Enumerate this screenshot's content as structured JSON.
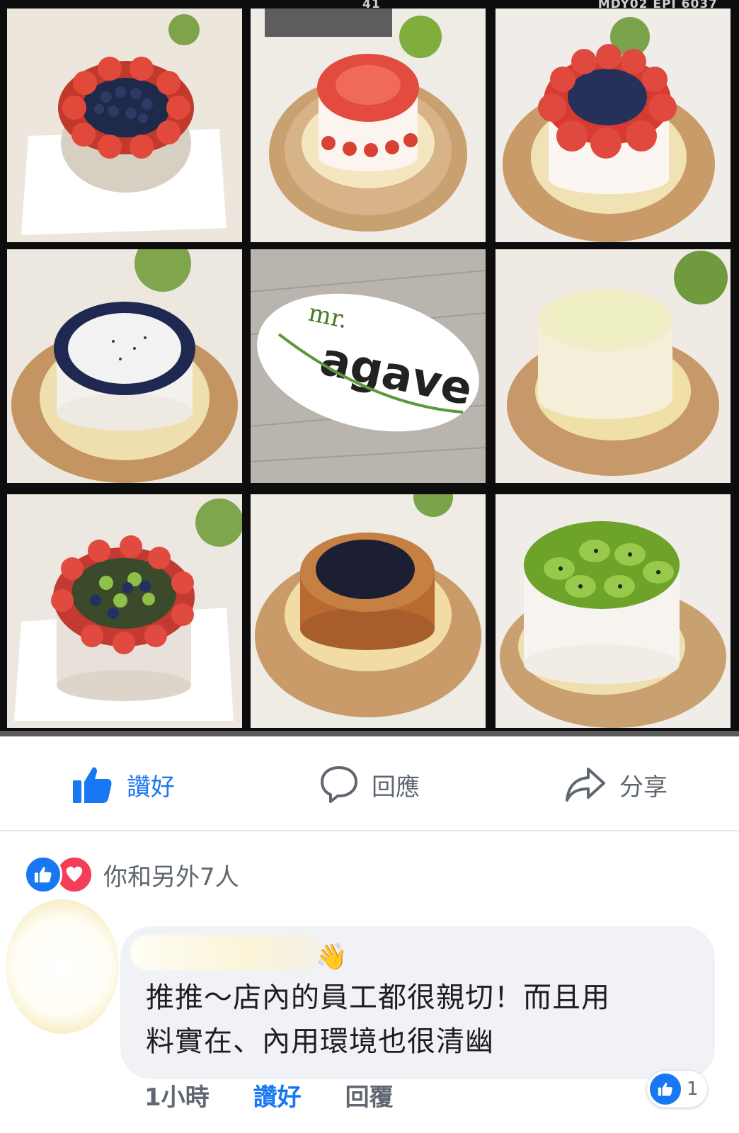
{
  "collage": {
    "film_number": "41",
    "film_code": "MDY02 EPI 6037",
    "logo_text_top": "mr.",
    "logo_text_main": "agave",
    "tiles": [
      {
        "name": "strawberry-blueberry-cake"
      },
      {
        "name": "strawberry-fraisier-cake"
      },
      {
        "name": "strawberry-blueberry-tall-cake"
      },
      {
        "name": "blueberry-ring-cake"
      },
      {
        "name": "mr-agave-logo"
      },
      {
        "name": "lemon-mousse-cake"
      },
      {
        "name": "mixed-fruit-cake"
      },
      {
        "name": "blueberry-cheesecake"
      },
      {
        "name": "kiwi-cake"
      }
    ]
  },
  "actions": {
    "like_label": "讚好",
    "comment_label": "回應",
    "share_label": "分享",
    "like_color": "#1877f2"
  },
  "reactions": {
    "summary": "你和另外7人",
    "types": [
      "like-icon",
      "love-icon"
    ]
  },
  "comment": {
    "wave_emoji": "👋",
    "text_line1": "推推～店內的員工都很親切！而且用",
    "text_line2": "料實在、內用環境也很清幽",
    "time": "1小時",
    "like_label": "讚好",
    "reply_label": "回覆",
    "like_count": "1"
  }
}
